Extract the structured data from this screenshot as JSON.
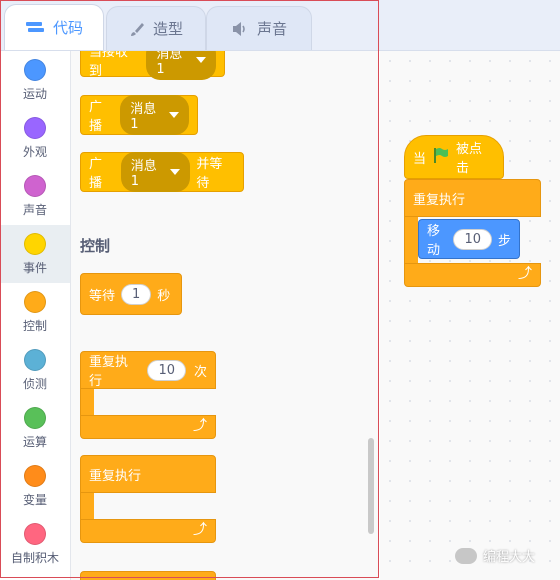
{
  "tabs": [
    {
      "label": "代码",
      "icon": "code-icon"
    },
    {
      "label": "造型",
      "icon": "brush-icon"
    },
    {
      "label": "声音",
      "icon": "speaker-icon"
    }
  ],
  "categories": [
    {
      "label": "运动",
      "color": "#4c97ff"
    },
    {
      "label": "外观",
      "color": "#9966ff"
    },
    {
      "label": "声音",
      "color": "#cf63cf"
    },
    {
      "label": "事件",
      "color": "#ffd500"
    },
    {
      "label": "控制",
      "color": "#ffab19"
    },
    {
      "label": "侦测",
      "color": "#5cb1d6"
    },
    {
      "label": "运算",
      "color": "#59c059"
    },
    {
      "label": "变量",
      "color": "#ff8c1a"
    },
    {
      "label": "自制积木",
      "color": "#ff6680"
    }
  ],
  "palette": {
    "when_receive": {
      "prefix": "当接收到",
      "message": "消息1"
    },
    "broadcast": {
      "prefix": "广播",
      "message": "消息1"
    },
    "broadcast_wait": {
      "prefix": "广播",
      "message": "消息1",
      "suffix": "并等待"
    },
    "section_control": "控制",
    "wait": {
      "prefix": "等待",
      "value": "1",
      "suffix": "秒"
    },
    "repeat": {
      "prefix": "重复执行",
      "value": "10",
      "suffix": "次"
    },
    "forever": {
      "label": "重复执行"
    }
  },
  "script": {
    "hat": {
      "prefix": "当",
      "suffix": "被点击"
    },
    "forever_label": "重复执行",
    "move": {
      "prefix": "移动",
      "value": "10",
      "suffix": "步"
    }
  },
  "watermark": "编程大大"
}
